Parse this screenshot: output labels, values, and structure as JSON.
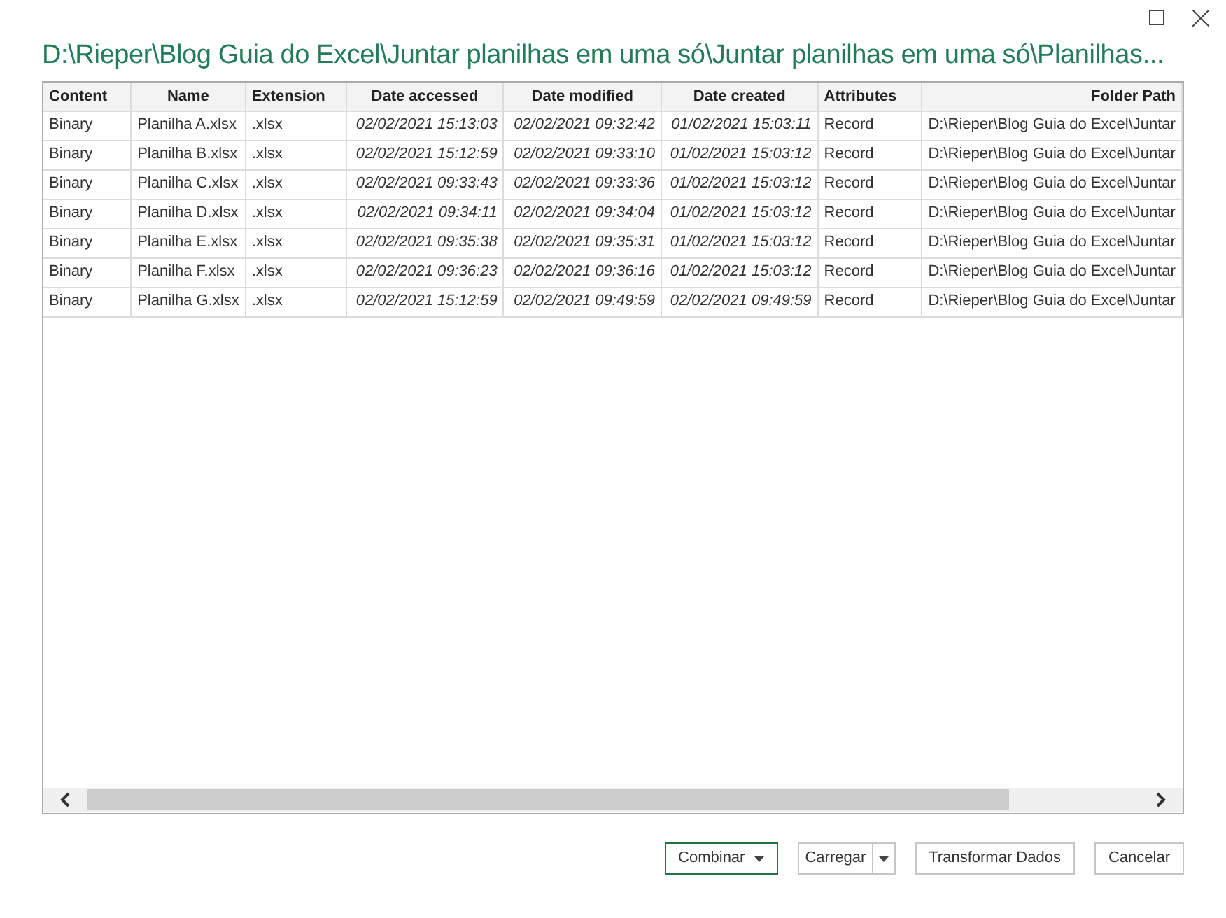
{
  "window": {
    "title": "D:\\Rieper\\Blog Guia do Excel\\Juntar planilhas em uma só\\Juntar planilhas em uma só\\Planilhas..."
  },
  "table": {
    "columns": [
      {
        "label": "Content",
        "kind": "text"
      },
      {
        "label": "Name",
        "kind": "text"
      },
      {
        "label": "Extension",
        "kind": "text"
      },
      {
        "label": "Date accessed",
        "kind": "date"
      },
      {
        "label": "Date modified",
        "kind": "date"
      },
      {
        "label": "Date created",
        "kind": "date"
      },
      {
        "label": "Attributes",
        "kind": "text"
      },
      {
        "label": "Folder Path",
        "kind": "text"
      }
    ],
    "rows": [
      [
        "Binary",
        "Planilha A.xlsx",
        ".xlsx",
        "02/02/2021 15:13:03",
        "02/02/2021 09:32:42",
        "01/02/2021 15:03:11",
        "Record",
        "D:\\Rieper\\Blog Guia do Excel\\Juntar"
      ],
      [
        "Binary",
        "Planilha B.xlsx",
        ".xlsx",
        "02/02/2021 15:12:59",
        "02/02/2021 09:33:10",
        "01/02/2021 15:03:12",
        "Record",
        "D:\\Rieper\\Blog Guia do Excel\\Juntar"
      ],
      [
        "Binary",
        "Planilha C.xlsx",
        ".xlsx",
        "02/02/2021 09:33:43",
        "02/02/2021 09:33:36",
        "01/02/2021 15:03:12",
        "Record",
        "D:\\Rieper\\Blog Guia do Excel\\Juntar"
      ],
      [
        "Binary",
        "Planilha D.xlsx",
        ".xlsx",
        "02/02/2021 09:34:11",
        "02/02/2021 09:34:04",
        "01/02/2021 15:03:12",
        "Record",
        "D:\\Rieper\\Blog Guia do Excel\\Juntar"
      ],
      [
        "Binary",
        "Planilha E.xlsx",
        ".xlsx",
        "02/02/2021 09:35:38",
        "02/02/2021 09:35:31",
        "01/02/2021 15:03:12",
        "Record",
        "D:\\Rieper\\Blog Guia do Excel\\Juntar"
      ],
      [
        "Binary",
        "Planilha F.xlsx",
        ".xlsx",
        "02/02/2021 09:36:23",
        "02/02/2021 09:36:16",
        "01/02/2021 15:03:12",
        "Record",
        "D:\\Rieper\\Blog Guia do Excel\\Juntar"
      ],
      [
        "Binary",
        "Planilha G.xlsx",
        ".xlsx",
        "02/02/2021 15:12:59",
        "02/02/2021 09:49:59",
        "02/02/2021 09:49:59",
        "Record",
        "D:\\Rieper\\Blog Guia do Excel\\Juntar"
      ]
    ]
  },
  "buttons": [
    {
      "label": "Combinar",
      "kind": "dropdown",
      "primary": true
    },
    {
      "label": "Carregar",
      "kind": "split",
      "primary": false
    },
    {
      "label": "Transformar Dados",
      "kind": "plain",
      "primary": false
    },
    {
      "label": "Cancelar",
      "kind": "plain",
      "primary": false
    }
  ]
}
